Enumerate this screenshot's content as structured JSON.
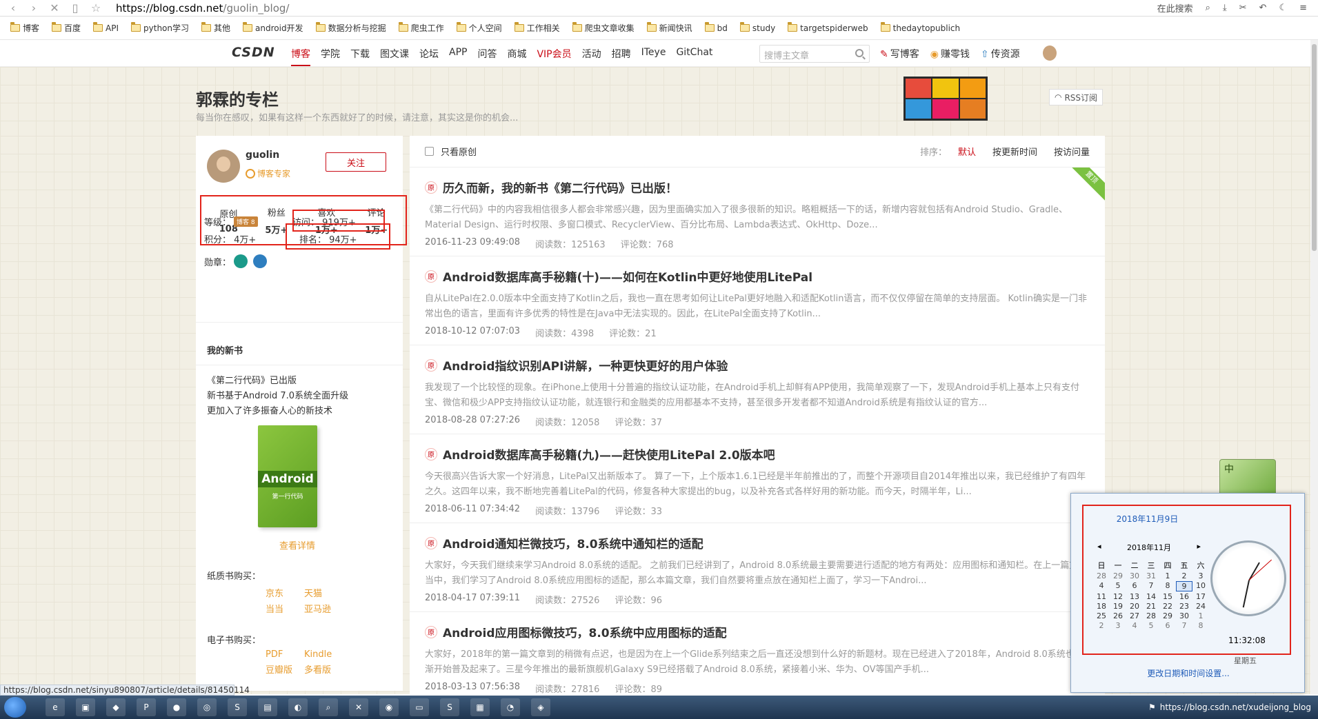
{
  "browser": {
    "url_host": "https://blog.csdn.net",
    "url_path": "/guolin_blog/",
    "search_label": "在此搜索",
    "bookmarks": [
      "博客",
      "百度",
      "API",
      "python学习",
      "其他",
      "android开发",
      "数据分析与挖掘",
      "爬虫工作",
      "个人空间",
      "工作相关",
      "爬虫文章收集",
      "新闻快讯",
      "bd",
      "study",
      "targetspiderweb",
      "thedaytopublich"
    ],
    "status_url": "https://blog.csdn.net/sinyu890807/article/details/81450114"
  },
  "header": {
    "logo": "CSDN",
    "nav": [
      "博客",
      "学院",
      "下载",
      "图文课",
      "论坛",
      "APP",
      "问答",
      "商城",
      "VIP会员",
      "活动",
      "招聘",
      "ITeye",
      "GitChat"
    ],
    "search_placeholder": "搜博主文章",
    "write_blog": "写博客",
    "earn_money": "赚零钱",
    "upload": "传资源"
  },
  "blog": {
    "title": "郭霖的专栏",
    "description": "每当你在感叹，如果有这样一个东西就好了的时候，请注意，其实这是你的机会...",
    "rss": "RSS订阅"
  },
  "profile": {
    "name": "guolin",
    "badge": "博客专家",
    "follow": "关注",
    "stats": [
      {
        "label": "原创",
        "value": "108"
      },
      {
        "label": "粉丝",
        "value": "5万+"
      },
      {
        "label": "喜欢",
        "value": "1万+"
      },
      {
        "label": "评论",
        "value": "1万+"
      }
    ],
    "level_label": "等级：",
    "level_badge": "博客 8",
    "visits": "访问：  919万+",
    "score": "积分：  4万+",
    "rank": "排名：  94万+",
    "medals_label": "勋章："
  },
  "book": {
    "heading": "我的新书",
    "lines": [
      "《第二行代码》已出版",
      "新书基于Android 7.0系统全面升级",
      "更加入了许多振奋人心的新技术"
    ],
    "cover_title": "Android",
    "cover_sub": "第一行代码",
    "detail": "查看详情",
    "paper_label": "纸质书购买：",
    "paper_links": [
      "京东",
      "天猫",
      "当当",
      "亚马逊"
    ],
    "ebook_label": "电子书购买：",
    "ebook_links": [
      "PDF",
      "Kindle",
      "豆瓣版",
      "多看版"
    ]
  },
  "filter": {
    "only_original": "只看原创",
    "sort_label": "排序：",
    "sort_default": "默认",
    "sort_updated": "按更新时间",
    "sort_views": "按访问量"
  },
  "articles": [
    {
      "title": "历久而新，我的新书《第二行代码》已出版！",
      "desc": "《第二行代码》中的内容我相信很多人都会非常感兴趣，因为里面确实加入了很多很新的知识。略粗概括一下的话，新增内容就包括有Android Studio、Gradle、Material Design、运行时权限、多窗口模式、RecyclerView、百分比布局、Lambda表达式、OkHttp、Doze...",
      "date": "2016-11-23 09:49:08",
      "reads": "阅读数：125163",
      "comments": "评论数：768",
      "pinned": "置顶"
    },
    {
      "title": "Android数据库高手秘籍(十)——如何在Kotlin中更好地使用LitePal",
      "desc": "自从LitePal在2.0.0版本中全面支持了Kotlin之后，我也一直在思考如何让LitePal更好地融入和适配Kotlin语言，而不仅仅停留在简单的支持层面。 Kotlin确实是一门非常出色的语言，里面有许多优秀的特性是在Java中无法实现的。因此，在LitePal全面支持了Kotlin...",
      "date": "2018-10-12 07:07:03",
      "reads": "阅读数：4398",
      "comments": "评论数：21"
    },
    {
      "title": "Android指纹识别API讲解，一种更快更好的用户体验",
      "desc": "我发现了一个比较怪的现象。在iPhone上使用十分普遍的指纹认证功能，在Android手机上却鲜有APP使用，我简单观察了一下，发现Android手机上基本上只有支付宝、微信和极少APP支持指纹认证功能，就连银行和金融类的应用都基本不支持，甚至很多开发者都不知道Android系统是有指纹认证的官方...",
      "date": "2018-08-28 07:27:26",
      "reads": "阅读数：12058",
      "comments": "评论数：37"
    },
    {
      "title": "Android数据库高手秘籍(九)——赶快使用LitePal 2.0版本吧",
      "desc": "今天很高兴告诉大家一个好消息，LitePal又出新版本了。 算了一下，上个版本1.6.1已经是半年前推出的了，而整个开源项目自2014年推出以来，我已经维护了有四年之久。这四年以来，我不断地完善着LitePal的代码，修复各种大家提出的bug，以及补充各式各样好用的新功能。而今天，时隔半年，Li...",
      "date": "2018-06-11 07:34:42",
      "reads": "阅读数：13796",
      "comments": "评论数：33"
    },
    {
      "title": "Android通知栏微技巧，8.0系统中通知栏的适配",
      "desc": "大家好，今天我们继续来学习Android 8.0系统的适配。 之前我们已经讲到了，Android 8.0系统最主要需要进行适配的地方有两处：应用图标和通知栏。在上一篇文章当中，我们学习了Android 8.0系统应用图标的适配，那么本篇文章，我们自然要将重点放在通知栏上面了，学习一下Androi...",
      "date": "2018-04-17 07:39:11",
      "reads": "阅读数：27526",
      "comments": "评论数：96"
    },
    {
      "title": "Android应用图标微技巧，8.0系统中应用图标的适配",
      "desc": "大家好，2018年的第一篇文章到的稍微有点迟，也是因为在上一个Glide系列结束之后一直还没想到什么好的新题材。现在已经进入了2018年，Android 8.0系统也逐渐开始普及起来了。三星今年推出的最新旗舰机Galaxy S9已经搭载了Android 8.0系统，紧接着小米、华为、OV等国产手机...",
      "date": "2018-03-13 07:56:38",
      "reads": "阅读数：27816",
      "comments": "评论数：89"
    }
  ],
  "calendar": {
    "full_date": "2018年11月9日",
    "month": "2018年11月",
    "weekdays": [
      "日",
      "一",
      "二",
      "三",
      "四",
      "五",
      "六"
    ],
    "days": [
      [
        "28",
        "29",
        "30",
        "31",
        "1",
        "2",
        "3"
      ],
      [
        "4",
        "5",
        "6",
        "7",
        "8",
        "9",
        "10"
      ],
      [
        "11",
        "12",
        "13",
        "14",
        "15",
        "16",
        "17"
      ],
      [
        "18",
        "19",
        "20",
        "21",
        "22",
        "23",
        "24"
      ],
      [
        "25",
        "26",
        "27",
        "28",
        "29",
        "30",
        "1"
      ],
      [
        "2",
        "3",
        "4",
        "5",
        "6",
        "7",
        "8"
      ]
    ],
    "time": "11:32:08",
    "weekday": "星期五",
    "change_link": "更改日期和时间设置...",
    "gadget_label": "中"
  },
  "taskbar": {
    "tray_text": "https://blog.csdn.net/xudeijong_blog"
  }
}
